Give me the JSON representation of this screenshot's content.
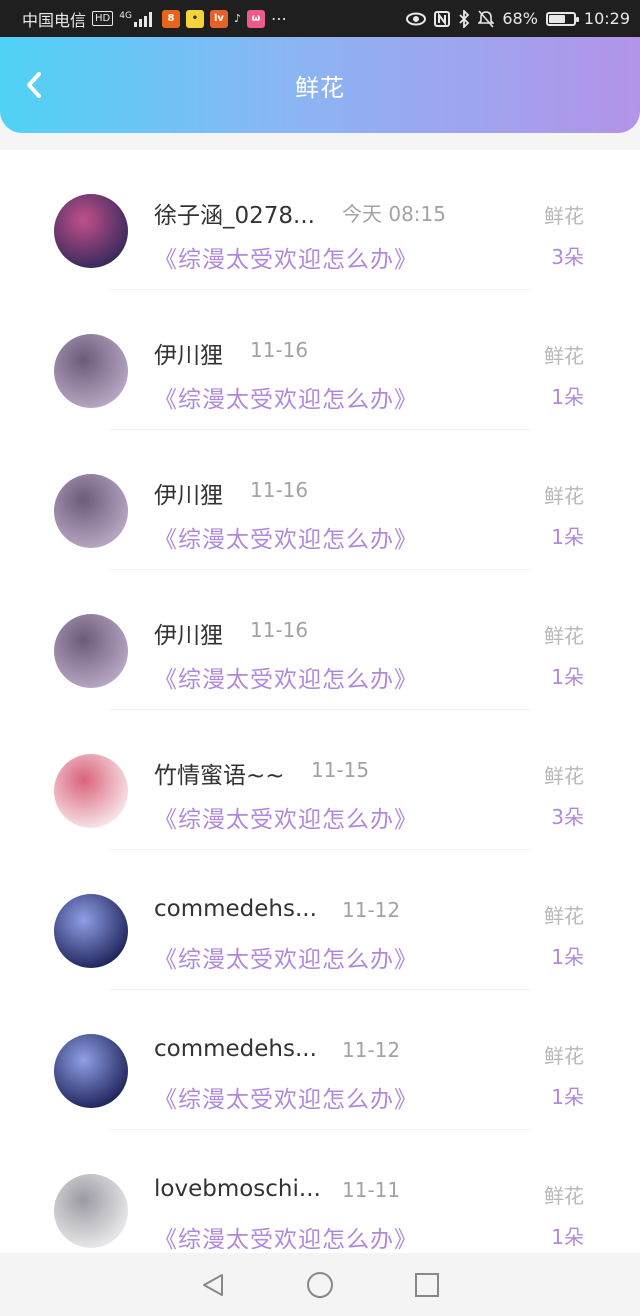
{
  "status_bar": {
    "carrier": "中国电信",
    "hd": "HD",
    "network": "4G",
    "battery_percent": "68%",
    "battery_level": 0.68,
    "time": "10:29"
  },
  "header": {
    "title": "鲜花",
    "back_icon": "chevron-left-icon"
  },
  "list": {
    "items": [
      {
        "user": "徐子涵_0278...",
        "time": "今天 08:15",
        "book": "《综漫太受欢迎怎么办》",
        "gift_label": "鲜花",
        "count": "3朵",
        "avatar_colors": [
          "#3a2a5c",
          "#c0508a"
        ]
      },
      {
        "user": "伊川狸",
        "time": "11-16",
        "book": "《综漫太受欢迎怎么办》",
        "gift_label": "鲜花",
        "count": "1朵",
        "avatar_colors": [
          "#b7a6c2",
          "#6a5b7a"
        ]
      },
      {
        "user": "伊川狸",
        "time": "11-16",
        "book": "《综漫太受欢迎怎么办》",
        "gift_label": "鲜花",
        "count": "1朵",
        "avatar_colors": [
          "#b7a6c2",
          "#6a5b7a"
        ]
      },
      {
        "user": "伊川狸",
        "time": "11-16",
        "book": "《综漫太受欢迎怎么办》",
        "gift_label": "鲜花",
        "count": "1朵",
        "avatar_colors": [
          "#b7a6c2",
          "#6a5b7a"
        ]
      },
      {
        "user": "竹情蜜语~~",
        "time": "11-15",
        "book": "《综漫太受欢迎怎么办》",
        "gift_label": "鲜花",
        "count": "3朵",
        "avatar_colors": [
          "#f7e3e8",
          "#d9637a"
        ]
      },
      {
        "user": "commedehs...",
        "time": "11-12",
        "book": "《综漫太受欢迎怎么办》",
        "gift_label": "鲜花",
        "count": "1朵",
        "avatar_colors": [
          "#22265e",
          "#8fa0e6"
        ]
      },
      {
        "user": "commedehs...",
        "time": "11-12",
        "book": "《综漫太受欢迎怎么办》",
        "gift_label": "鲜花",
        "count": "1朵",
        "avatar_colors": [
          "#22265e",
          "#8fa0e6"
        ]
      },
      {
        "user": "lovebmoschi...",
        "time": "11-11",
        "book": "《综漫太受欢迎怎么办》",
        "gift_label": "鲜花",
        "count": "1朵",
        "avatar_colors": [
          "#e8e8ea",
          "#9a9aa2"
        ]
      }
    ]
  },
  "nav_bar": {
    "buttons": [
      "back-triangle-icon",
      "home-circle-icon",
      "recents-square-icon"
    ]
  },
  "colors": {
    "header_gradient": [
      "#4fd2f5",
      "#8ab6f3",
      "#b393e8"
    ],
    "accent_purple": "#b189dc",
    "muted_gray": "#a3a3a3"
  }
}
